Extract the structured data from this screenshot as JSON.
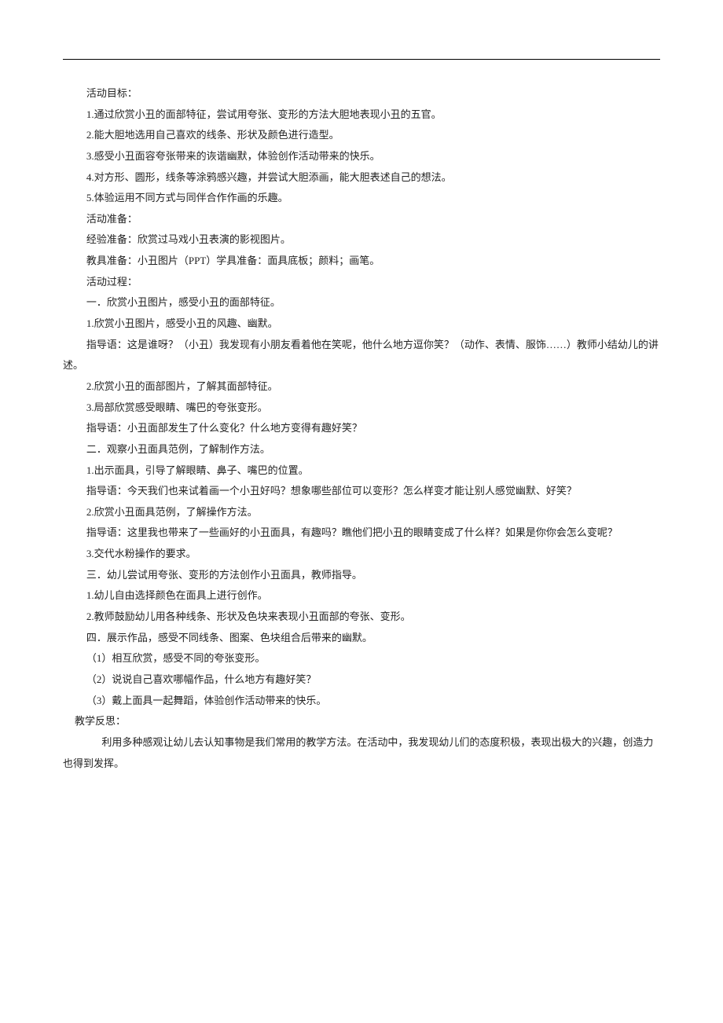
{
  "lines": [
    {
      "cls": "para",
      "text": "活动目标："
    },
    {
      "cls": "para",
      "text": "1.通过欣赏小丑的面部特征，尝试用夸张、变形的方法大胆地表现小丑的五官。"
    },
    {
      "cls": "para",
      "text": "2.能大胆地选用自己喜欢的线条、形状及颜色进行造型。"
    },
    {
      "cls": "para",
      "text": "3.感受小丑面容夸张带来的诙谐幽默，体验创作活动带来的快乐。"
    },
    {
      "cls": "para",
      "text": "4.对方形、圆形，线条等涂鸦感兴趣，并尝试大胆添画，能大胆表述自己的想法。"
    },
    {
      "cls": "para",
      "text": "5.体验运用不同方式与同伴合作作画的乐趣。"
    },
    {
      "cls": "para",
      "text": "活动准备："
    },
    {
      "cls": "para",
      "text": "经验准备：欣赏过马戏小丑表演的影视图片。"
    },
    {
      "cls": "para",
      "text": "教具准备：小丑图片（PPT）学具准备：面具底板；颜料；画笔。"
    },
    {
      "cls": "para",
      "text": "活动过程："
    },
    {
      "cls": "para",
      "text": "一．欣赏小丑图片，感受小丑的面部特征。"
    },
    {
      "cls": "para",
      "text": "1.欣赏小丑图片，感受小丑的风趣、幽默。"
    },
    {
      "cls": "para-wrap",
      "text": "指导语：这是谁呀？（小丑）我发现有小朋友看着他在笑呢，他什么地方逗你笑？（动作、表情、服饰……）教师小结幼儿的讲述。"
    },
    {
      "cls": "para",
      "text": "2.欣赏小丑的面部图片，了解其面部特征。"
    },
    {
      "cls": "para",
      "text": "3.局部欣赏感受眼睛、嘴巴的夸张变形。"
    },
    {
      "cls": "para",
      "text": "指导语：小丑面部发生了什么变化？什么地方变得有趣好笑？"
    },
    {
      "cls": "para",
      "text": "二．观察小丑面具范例，了解制作方法。"
    },
    {
      "cls": "para",
      "text": "1.出示面具，引导了解眼睛、鼻子、嘴巴的位置。"
    },
    {
      "cls": "para",
      "text": "指导语：今天我们也来试着画一个小丑好吗？想象哪些部位可以变形？怎么样变才能让别人感觉幽默、好笑？"
    },
    {
      "cls": "para",
      "text": "2.欣赏小丑面具范例，了解操作方法。"
    },
    {
      "cls": "para-wrap",
      "text": "指导语：这里我也带来了一些画好的小丑面具，有趣吗？瞧他们把小丑的眼睛变成了什么样？如果是你你会怎么变呢？"
    },
    {
      "cls": "para",
      "text": "3.交代水粉操作的要求。"
    },
    {
      "cls": "para",
      "text": "三．幼儿尝试用夸张、变形的方法创作小丑面具，教师指导。"
    },
    {
      "cls": "para",
      "text": "1.幼儿自由选择颜色在面具上进行创作。"
    },
    {
      "cls": "para",
      "text": "2.教师鼓励幼儿用各种线条、形状及色块来表现小丑面部的夸张、变形。"
    },
    {
      "cls": "para",
      "text": "四．展示作品，感受不同线条、图案、色块组合后带来的幽默。"
    },
    {
      "cls": "para",
      "text": "（1）相互欣赏，感受不同的夸张变形。"
    },
    {
      "cls": "para",
      "text": "（2）说说自己喜欢哪幅作品，什么地方有趣好笑？"
    },
    {
      "cls": "para",
      "text": "（3）戴上面具一起舞蹈，体验创作活动带来的快乐。"
    },
    {
      "cls": "para-less",
      "text": "教学反思："
    },
    {
      "cls": "para-extra",
      "text": "利用多种感观让幼儿去认知事物是我们常用的教学方法。在活动中，我发现幼儿们的态度积极，表现出极大的兴趣，创造力也得到发挥。"
    }
  ]
}
